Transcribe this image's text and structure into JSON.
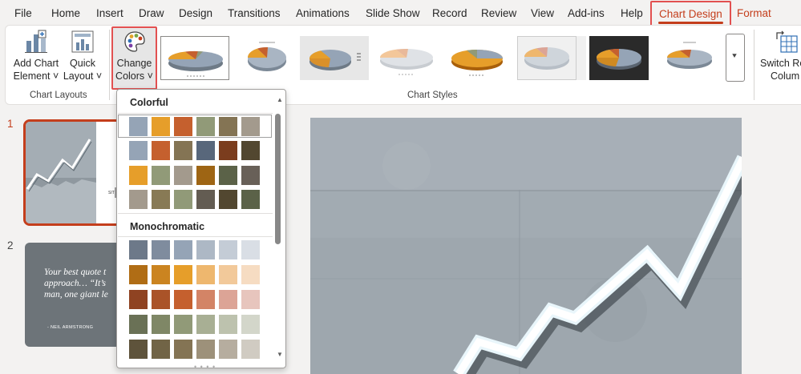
{
  "menu": {
    "tabs": [
      {
        "label": "File"
      },
      {
        "label": "Home"
      },
      {
        "label": "Insert"
      },
      {
        "label": "Draw"
      },
      {
        "label": "Design"
      },
      {
        "label": "Transitions"
      },
      {
        "label": "Animations"
      },
      {
        "label": "Slide Show"
      },
      {
        "label": "Record"
      },
      {
        "label": "Review"
      },
      {
        "label": "View"
      },
      {
        "label": "Add-ins"
      },
      {
        "label": "Help"
      },
      {
        "label": "Chart Design"
      },
      {
        "label": "Format"
      }
    ],
    "active_tab": "Chart Design"
  },
  "ribbon": {
    "add_chart_element": {
      "line1": "Add Chart",
      "line2": "Element ˅"
    },
    "quick_layout": {
      "line1": "Quick",
      "line2": "Layout ˅"
    },
    "change_colors": {
      "line1": "Change",
      "line2": "Colors ˅"
    },
    "chart_layouts_label": "Chart Layouts",
    "chart_styles_label": "Chart Styles",
    "switch_row": {
      "line1": "Switch Ro",
      "line2": "Colum"
    },
    "gallery_more_glyph": "⯆"
  },
  "dropdown": {
    "colorful_heading": "Colorful",
    "monochromatic_heading": "Monochromatic",
    "colorful_palettes": [
      [
        "#95a4b6",
        "#e69e2a",
        "#c5602e",
        "#919a78",
        "#847454",
        "#a39a8d"
      ],
      [
        "#95a4b6",
        "#c5602e",
        "#847454",
        "#58677b",
        "#7b3d1e",
        "#524730"
      ],
      [
        "#e69e2a",
        "#919a78",
        "#a39a8d",
        "#9e6514",
        "#5b6248",
        "#686058"
      ],
      [
        "#a39a8d",
        "#887a55",
        "#919a78",
        "#635c52",
        "#524730",
        "#5b6248"
      ]
    ],
    "mono_palettes": [
      [
        "#6d7989",
        "#7f8c9e",
        "#95a4b6",
        "#adb8c5",
        "#c4ccd6",
        "#d9dee5"
      ],
      [
        "#b06d15",
        "#cb8420",
        "#e69e2a",
        "#eeb76e",
        "#f2c99a",
        "#f6dcc2"
      ],
      [
        "#8f4322",
        "#aa5328",
        "#c5602e",
        "#d38466",
        "#dca496",
        "#e7c5bd"
      ],
      [
        "#6a7156",
        "#7f8766",
        "#919a78",
        "#a8af94",
        "#bdc2ae",
        "#d3d6ca"
      ],
      [
        "#5e533b",
        "#716446",
        "#847454",
        "#9d917a",
        "#b6ad9f",
        "#d0cbc2"
      ]
    ],
    "scroll_up": "▲",
    "scroll_down": "▼",
    "grip": "• • • •"
  },
  "slides": {
    "numbers": [
      "1",
      "2"
    ],
    "thumb1_caption": "SIT",
    "thumb2_quote": "Your best quote t approach… “It’s man, one giant le",
    "thumb2_author": "- NEIL ARMSTRONG"
  },
  "colors": {
    "accent": "#c43e1c",
    "highlight": "#e25050",
    "canvas": "#9ea7ae"
  }
}
